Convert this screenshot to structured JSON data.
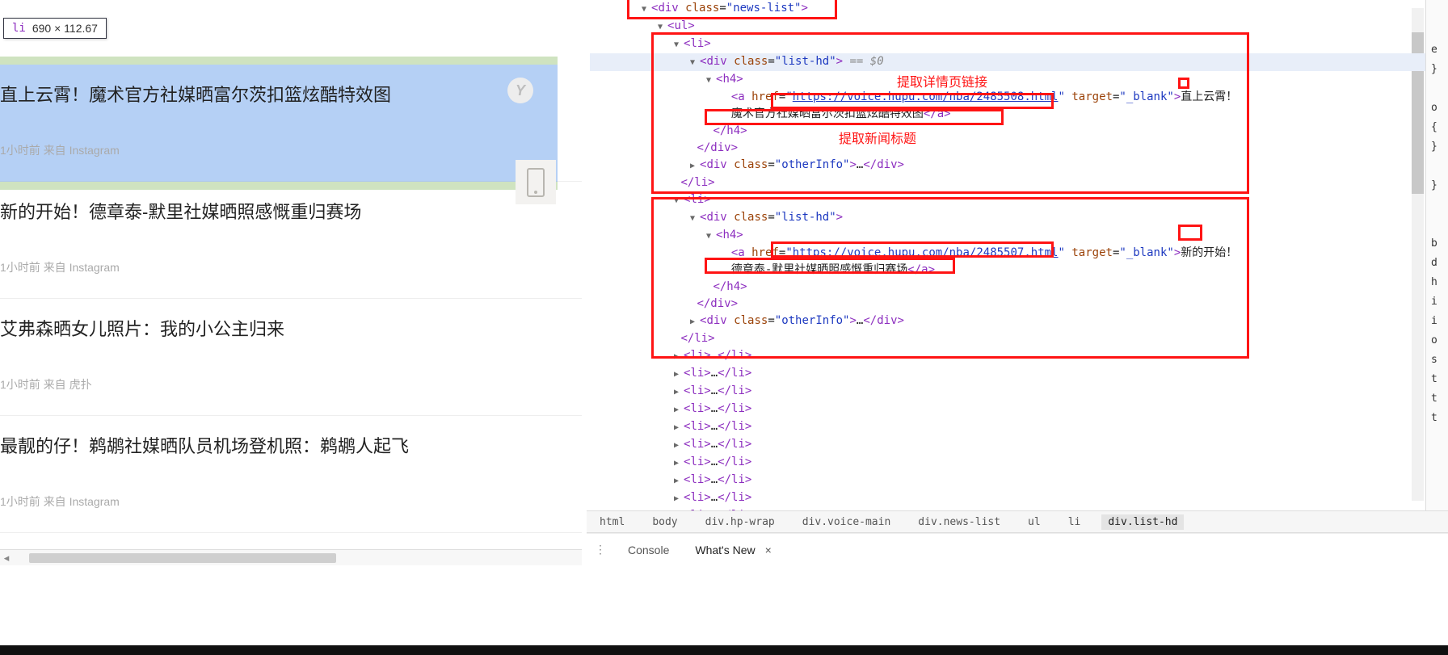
{
  "tooltip": {
    "tag": "li",
    "dims": "690 × 112.67"
  },
  "news": [
    {
      "title": "直上云霄！魔术官方社媒晒富尔茨扣篮炫酷特效图",
      "time": "1小时前",
      "source_label": "来自",
      "source": "Instagram",
      "badge": "Y"
    },
    {
      "title": "新的开始！德章泰-默里社媒晒照感慨重归赛场",
      "time": "1小时前",
      "source_label": "来自",
      "source": "Instagram"
    },
    {
      "title": "艾弗森晒女儿照片：我的小公主归来",
      "time": "1小时前",
      "source_label": "来自",
      "source": "虎扑"
    },
    {
      "title": "最靓的仔！鹈鹕社媒晒队员机场登机照：鹈鹕人起飞",
      "time": "1小时前",
      "source_label": "来自",
      "source": "Instagram"
    }
  ],
  "dom": {
    "root_line": "<div class=\"news-list\">",
    "ul_line": "<ul>",
    "li1": {
      "div_open": "<div class=\"list-hd\">",
      "eqsel": " == $0",
      "a_href": "https://voice.hupu.com/nba/2485508.html",
      "a_target": "_blank",
      "a_text_head": "直上云霄！",
      "a_text_wrap": "魔术官方社媒晒富尔茨扣篮炫酷特效图",
      "otherinfo": "<div class=\"otherInfo\">…</div>"
    },
    "li2": {
      "div_open": "<div class=\"list-hd\">",
      "a_href": "https://voice.hupu.com/nba/2485507.html",
      "a_target": "_blank",
      "a_text_head": "新的开始！",
      "a_text_wrap": "德章泰-默里社媒晒照感慨重归赛场",
      "otherinfo": "<div class=\"otherInfo\">…</div>"
    },
    "collapsed_li": "<li>…</li>",
    "annotations": {
      "detail_link": "提取详情页链接",
      "news_title": "提取新闻标题"
    }
  },
  "breadcrumb": [
    "html",
    "body",
    "div.hp-wrap",
    "div.voice-main",
    "div.news-list",
    "ul",
    "li",
    "div.list-hd"
  ],
  "drawer": {
    "console": "Console",
    "whatsnew": "What's New"
  },
  "rightstrip": [
    "e",
    "}",
    " ",
    "o",
    "{",
    "}",
    " ",
    "}",
    " ",
    " ",
    "b",
    "d",
    "h",
    "i",
    "i",
    "o",
    "s",
    "t",
    "t",
    "t"
  ]
}
